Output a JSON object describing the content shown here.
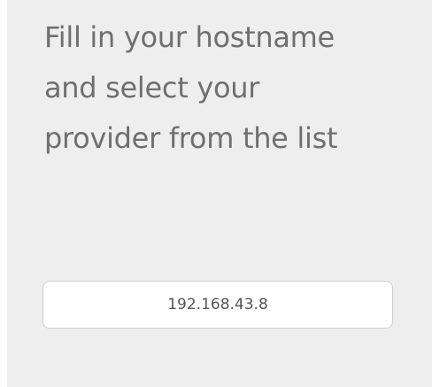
{
  "instructions": {
    "line1": "Fill in your hostname",
    "line2": "and select your",
    "line3": "provider from the list"
  },
  "hostname_input": {
    "value": "192.168.43.8"
  }
}
